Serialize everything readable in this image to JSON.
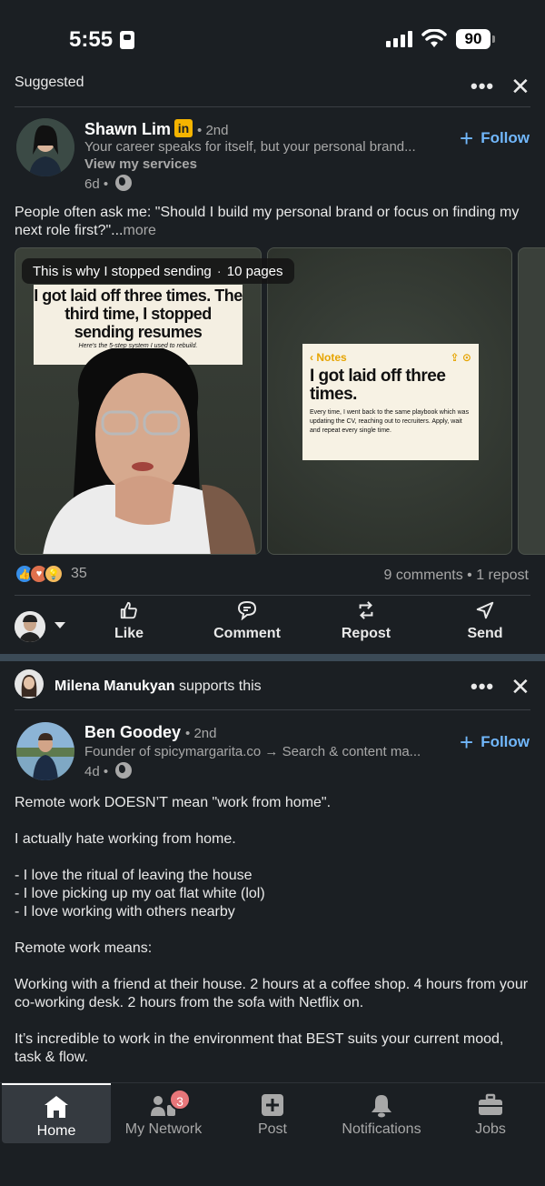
{
  "status_bar": {
    "time": "5:55",
    "battery": "90"
  },
  "post1": {
    "context_label": "Suggested",
    "author": {
      "name": "Shawn Lim",
      "badge": "in",
      "degree": "2nd",
      "headline": "Your career speaks for itself, but your personal brand...",
      "services_link": "View my services",
      "age": "6d"
    },
    "follow_label": "Follow",
    "text_main": "People often ask me: \"Should I build my personal brand or focus on finding my next role first?\"...",
    "text_more": "more",
    "document": {
      "title": "This is why I stopped sending",
      "pages": "10 pages",
      "cover_title": "I got laid off three times. The third time, I stopped sending resumes",
      "cover_subtitle": "Here's the 5-step system I used to rebuild.",
      "note_back": "Notes",
      "note_title": "I got laid off three times.",
      "note_body": "Every time, I went back to the same playbook which was updating the CV, reaching out to recruiters. Apply, wait and repeat every single time."
    },
    "reactions_count": "35",
    "comments": "9 comments",
    "reposts": "1 repost",
    "actions": {
      "like": "Like",
      "comment": "Comment",
      "repost": "Repost",
      "send": "Send"
    }
  },
  "post2": {
    "context_name": "Milena Manukyan",
    "context_suffix": "supports this",
    "author": {
      "name": "Ben Goodey",
      "degree": "2nd",
      "headline": "Founder of spicymargarita.co → Search & content ma...",
      "age": "4d"
    },
    "follow_label": "Follow",
    "paragraphs": [
      "Remote work DOESN’T mean \"work from home\".",
      "I actually hate working from home.",
      "- I love the ritual of leaving the house",
      "- I love picking up my oat flat white (lol)",
      "- I love working with others nearby",
      "Remote work means:",
      "Working with a friend at their house. 2 hours at a coffee shop. 4 hours from your co-working desk. 2 hours from the sofa with Netflix on.",
      "It’s incredible to work in the environment that BEST suits your current mood, task & flow."
    ]
  },
  "tabbar": {
    "home": "Home",
    "network": "My Network",
    "network_badge": "3",
    "post": "Post",
    "notifications": "Notifications",
    "jobs": "Jobs"
  }
}
